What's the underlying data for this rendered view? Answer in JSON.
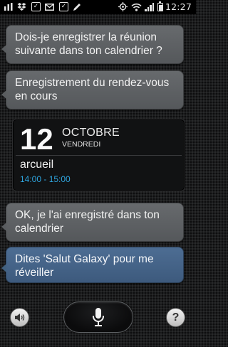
{
  "status_bar": {
    "time": "12:27",
    "notification_icons": [
      "bar-chart-icon",
      "dropbox-icon",
      "checkbox-icon",
      "mail-icon",
      "checkbox-icon",
      "pen-icon"
    ],
    "system_icons": [
      "location-icon",
      "wifi-icon",
      "signal-icon",
      "battery-icon"
    ]
  },
  "conversation": {
    "messages": [
      {
        "text": "Dois-je enregistrer la réunion suivante dans ton calendrier ?",
        "style": "assistant"
      },
      {
        "text": "Enregistrement du rendez-vous en cours",
        "style": "assistant"
      },
      {
        "text": "OK, je l'ai enregistré dans ton calendrier",
        "style": "assistant"
      },
      {
        "text": "Dites 'Salut Galaxy' pour me réveiller",
        "style": "hint"
      }
    ]
  },
  "calendar_event": {
    "day": "12",
    "month": "OCTOBRE",
    "weekday": "VENDREDI",
    "title": "arcueil",
    "time": "14:00 - 15:00"
  },
  "controls": {
    "left_icon": "speaker-icon",
    "center_icon": "microphone-icon",
    "right_label": "?"
  },
  "colors": {
    "assistant_bubble": "#5f6265",
    "hint_bubble": "#44638a",
    "event_time": "#2ea3dc"
  }
}
